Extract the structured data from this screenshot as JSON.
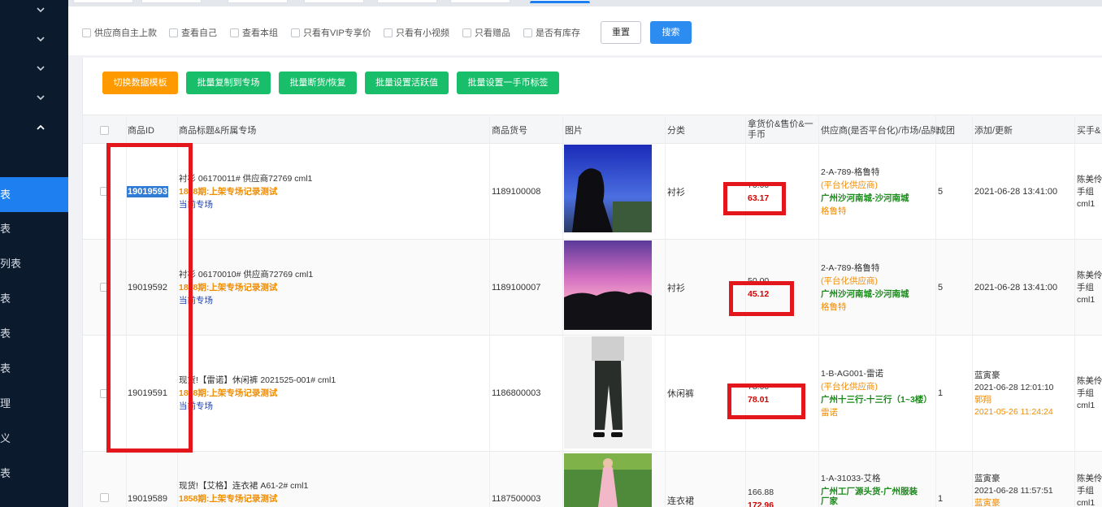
{
  "sidebar": {
    "items": [
      {
        "label": "表",
        "active": true
      },
      {
        "label": "表",
        "active": false
      },
      {
        "label": "列表",
        "active": false
      },
      {
        "label": "表",
        "active": false
      },
      {
        "label": "表",
        "active": false
      },
      {
        "label": "表",
        "active": false
      },
      {
        "label": "理",
        "active": false
      },
      {
        "label": "义",
        "active": false
      },
      {
        "label": "表",
        "active": false
      }
    ]
  },
  "filters": {
    "options": [
      "供应商自主上款",
      "查看自己",
      "查看本组",
      "只看有VIP专享价",
      "只看有小视频",
      "只看赠品",
      "是否有库存"
    ],
    "reset_label": "重置",
    "search_label": "搜索"
  },
  "actions": [
    {
      "label": "切换数据模板",
      "color": "#ff9900"
    },
    {
      "label": "批量复制到专场",
      "color": "#19be6b"
    },
    {
      "label": "批量断货/恢复",
      "color": "#19be6b"
    },
    {
      "label": "批量设置活跃值",
      "color": "#19be6b"
    },
    {
      "label": "批量设置一手币标签",
      "color": "#19be6b"
    }
  ],
  "table": {
    "headers": {
      "id": "商品ID",
      "title": "商品标题&所属专场",
      "code": "商品货号",
      "image": "图片",
      "category": "分类",
      "price_l1": "拿货价&售价&一",
      "price_l2": "手币",
      "supplier": "供应商(是否平台化)/市场/品牌",
      "deal": "成团",
      "added": "添加/更新",
      "buyer": "买手&"
    },
    "rows": [
      {
        "id": "19019593",
        "title": "衬衫 06170011# 供应商72769 cml1",
        "session": "1858期:上架专场记录测试",
        "venue": "当前专场",
        "code": "1189100008",
        "category": "衬衫",
        "price_top": "70.00",
        "price_sale": "63.17",
        "sup_code": "2-A-789-格鲁特",
        "sup_platform": "(平台化供应商)",
        "sup_market": "广州沙河南城-沙河南城",
        "sup_brand": "格鲁特",
        "deal": "5",
        "date1": "2021-06-28 13:41:00",
        "buyer1": "陈美伶",
        "buyer2": "手组",
        "buyer3": "cml1"
      },
      {
        "id": "19019592",
        "title": "衬衫 06170010# 供应商72769 cml1",
        "session": "1858期:上架专场记录测试",
        "venue": "当前专场",
        "code": "1189100007",
        "category": "衬衫",
        "price_top": "50.00",
        "price_sale": "45.12",
        "sup_code": "2-A-789-格鲁特",
        "sup_platform": "(平台化供应商)",
        "sup_market": "广州沙河南城-沙河南城",
        "sup_brand": "格鲁特",
        "deal": "5",
        "date1": "2021-06-28 13:41:00",
        "buyer1": "陈美伶",
        "buyer2": "手组",
        "buyer3": "cml1"
      },
      {
        "id": "19019591",
        "title": "现货!【雷诺】休闲裤 2021525-001# cml1",
        "session": "1858期:上架专场记录测试",
        "venue": "当前专场",
        "code": "1186800003",
        "category": "休闲裤",
        "price_top": "78.00",
        "price_sale": "78.01",
        "sup_code": "1-B-AG001-雷诺",
        "sup_platform": "(平台化供应商)",
        "sup_market": "广州十三行-十三行（1~3楼）",
        "sup_brand": "雷诺",
        "deal": "1",
        "date_name1": "蓝寅豪",
        "date1": "2021-06-28 12:01:10",
        "date_name2": "郭翔",
        "date2": "2021-05-26 11:24:24",
        "buyer1": "陈美伶",
        "buyer2": "手组",
        "buyer3": "cml1"
      },
      {
        "id": "19019589",
        "title": "现货!【艾格】连衣裙 A61-2# cml1",
        "session": "1858期:上架专场记录测试",
        "code": "1187500003",
        "category": "连衣裙",
        "price_top": "166.88",
        "price_sale": "172.96",
        "sup_code": "1-A-31033-艾格",
        "sup_market": "广州工厂源头货-广州服装厂家",
        "deal": "1",
        "date_name1": "蓝寅豪",
        "date1": "2021-06-28 11:57:51",
        "date_name2": "蓝寅豪",
        "buyer1": "陈美伶",
        "buyer2": "手组",
        "buyer3": "cml1"
      }
    ]
  },
  "colors": {
    "sidebar_bg": "#0c1a2e",
    "active_blue": "#1d7ff0",
    "annotation_red": "#e3161c"
  }
}
